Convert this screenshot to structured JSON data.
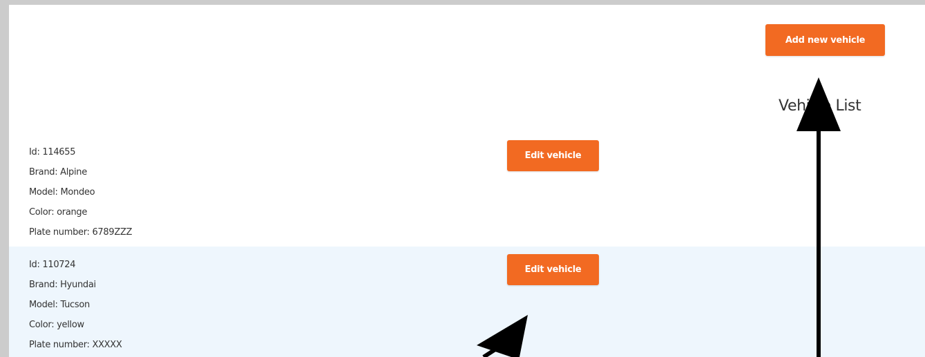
{
  "header": {
    "add_button_label": "Add new vehicle",
    "list_title": "Vehicle List"
  },
  "vehicles": [
    {
      "id": "Id: 114655",
      "brand": "Brand: Alpine",
      "model": "Model: Mondeo",
      "color": "Color: orange",
      "plate": "Plate number: 6789ZZZ",
      "edit_label": "Edit vehicle"
    },
    {
      "id": "Id: 110724",
      "brand": "Brand: Hyundai",
      "model": "Model: Tucson",
      "color": "Color: yellow",
      "plate": "Plate number: XXXXX",
      "edit_label": "Edit vehicle"
    }
  ],
  "colors": {
    "accent": "#f26a22",
    "row_alt_background": "#eef6fd",
    "frame": "#cccccc",
    "annotation_arrow": "#000000"
  },
  "annotations": {
    "arrow_icons": [
      "arrow-up-icon",
      "arrow-up-right-icon"
    ]
  }
}
